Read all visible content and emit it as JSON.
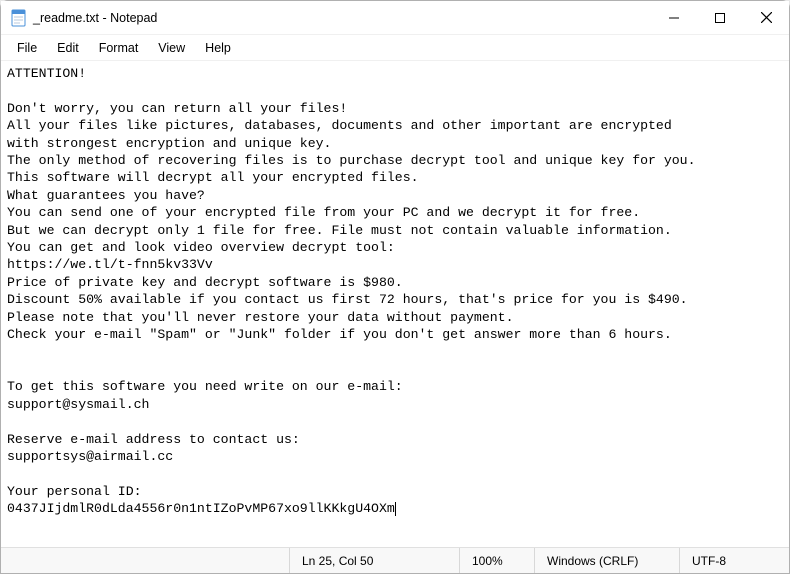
{
  "titlebar": {
    "title": "_readme.txt - Notepad"
  },
  "menu": {
    "file": "File",
    "edit": "Edit",
    "format": "Format",
    "view": "View",
    "help": "Help"
  },
  "body": {
    "lines": [
      "ATTENTION!",
      "",
      "Don't worry, you can return all your files!",
      "All your files like pictures, databases, documents and other important are encrypted",
      "with strongest encryption and unique key.",
      "The only method of recovering files is to purchase decrypt tool and unique key for you.",
      "This software will decrypt all your encrypted files.",
      "What guarantees you have?",
      "You can send one of your encrypted file from your PC and we decrypt it for free.",
      "But we can decrypt only 1 file for free. File must not contain valuable information.",
      "You can get and look video overview decrypt tool:",
      "https://we.tl/t-fnn5kv33Vv",
      "Price of private key and decrypt software is $980.",
      "Discount 50% available if you contact us first 72 hours, that's price for you is $490.",
      "Please note that you'll never restore your data without payment.",
      "Check your e-mail \"Spam\" or \"Junk\" folder if you don't get answer more than 6 hours.",
      "",
      "",
      "To get this software you need write on our e-mail:",
      "support@sysmail.ch",
      "",
      "Reserve e-mail address to contact us:",
      "supportsys@airmail.cc",
      "",
      "Your personal ID:",
      "0437JIjdmlR0dLda4556r0n1ntIZoPvMP67xo9llKKkgU4OXm"
    ]
  },
  "status": {
    "line_col": "Ln 25, Col 50",
    "zoom": "100%",
    "eol": "Windows (CRLF)",
    "encoding": "UTF-8"
  }
}
